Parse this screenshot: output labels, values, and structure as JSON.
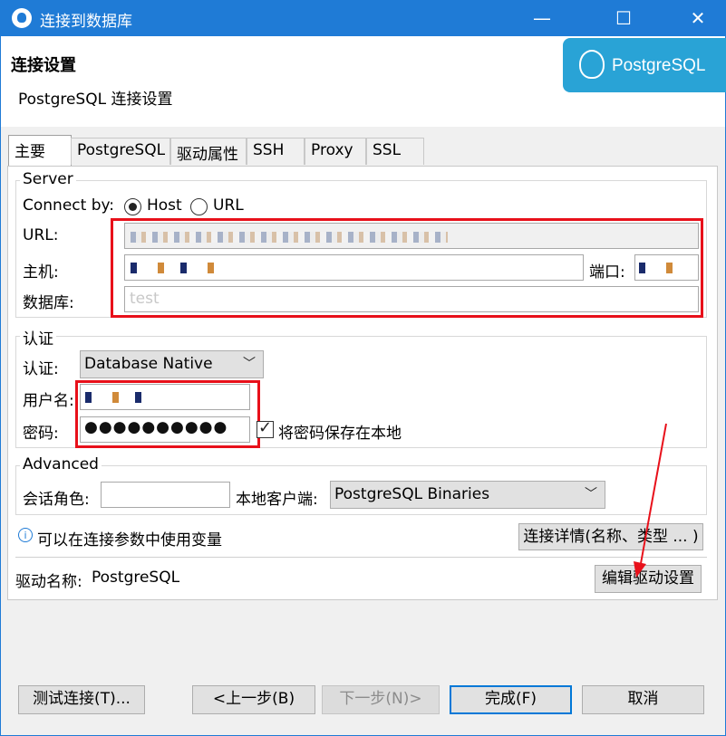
{
  "window": {
    "title": "连接到数据库"
  },
  "header": {
    "title": "连接设置",
    "subtitle": "PostgreSQL 连接设置",
    "logo": "PostgreSQL"
  },
  "tabs": [
    {
      "label": "主要",
      "active": true
    },
    {
      "label": "PostgreSQL"
    },
    {
      "label": "驱动属性"
    },
    {
      "label": "SSH"
    },
    {
      "label": "Proxy"
    },
    {
      "label": "SSL"
    }
  ],
  "server": {
    "legend": "Server",
    "connect_by_label": "Connect by:",
    "option_host": "Host",
    "option_url": "URL",
    "url_label": "URL:",
    "host_label": "主机:",
    "port_label": "端口:",
    "database_label": "数据库:",
    "database_value": "test"
  },
  "auth": {
    "legend": "认证",
    "auth_label": "认证:",
    "auth_value": "Database Native",
    "user_label": "用户名:",
    "password_label": "密码:",
    "password_mask": "●●●●●●●●●●",
    "save_password": "将密码保存在本地"
  },
  "advanced": {
    "legend": "Advanced",
    "role_label": "会话角色:",
    "client_label": "本地客户端:",
    "client_value": "PostgreSQL Binaries"
  },
  "info": {
    "text": "可以在连接参数中使用变量",
    "details_button": "连接详情(名称、类型 ... )"
  },
  "driver": {
    "label": "驱动名称:",
    "value": "PostgreSQL",
    "edit_button": "编辑驱动设置"
  },
  "footer": {
    "test": "测试连接(T)...",
    "back": "<上一步(B)",
    "next": "下一步(N)>",
    "finish": "完成(F)",
    "cancel": "取消"
  },
  "colors": {
    "accent": "#1f7bd6",
    "annotation": "#e8101a",
    "logo_bg": "#29a3d6"
  }
}
